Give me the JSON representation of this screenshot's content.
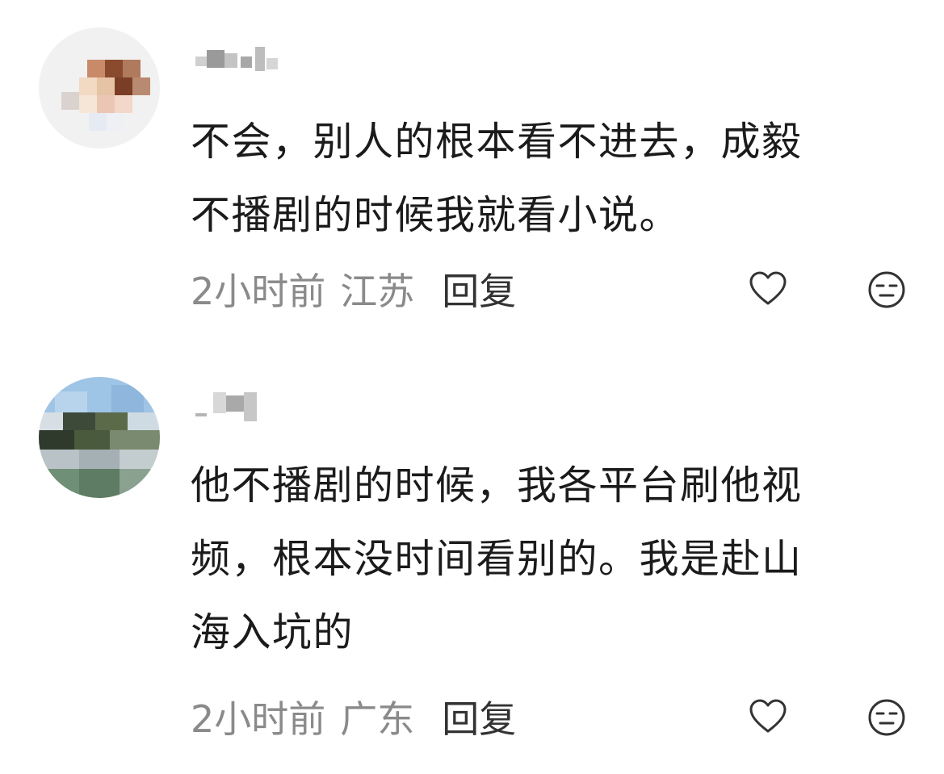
{
  "comments": [
    {
      "username": "",
      "content": "不会，别人的根本看不进去，成毅\n不播剧的时候我就看小说。",
      "time": "2小时前",
      "location": "江苏",
      "reply_label": "回复",
      "like_icon": "heart-outline-icon",
      "dislike_icon": "meh-face-icon"
    },
    {
      "username": "",
      "content": "他不播剧的时候，我各平台刷他视\n频，根本没时间看别的。我是赴山\n海入坑的",
      "time": "2小时前",
      "location": "广东",
      "reply_label": "回复",
      "like_icon": "heart-outline-icon",
      "dislike_icon": "meh-face-icon"
    }
  ],
  "colors": {
    "background": "#ffffff",
    "content_text": "#1b1b1b",
    "meta_text": "#8a8a8a",
    "reply_text": "#333333",
    "icon_stroke": "#333333"
  }
}
